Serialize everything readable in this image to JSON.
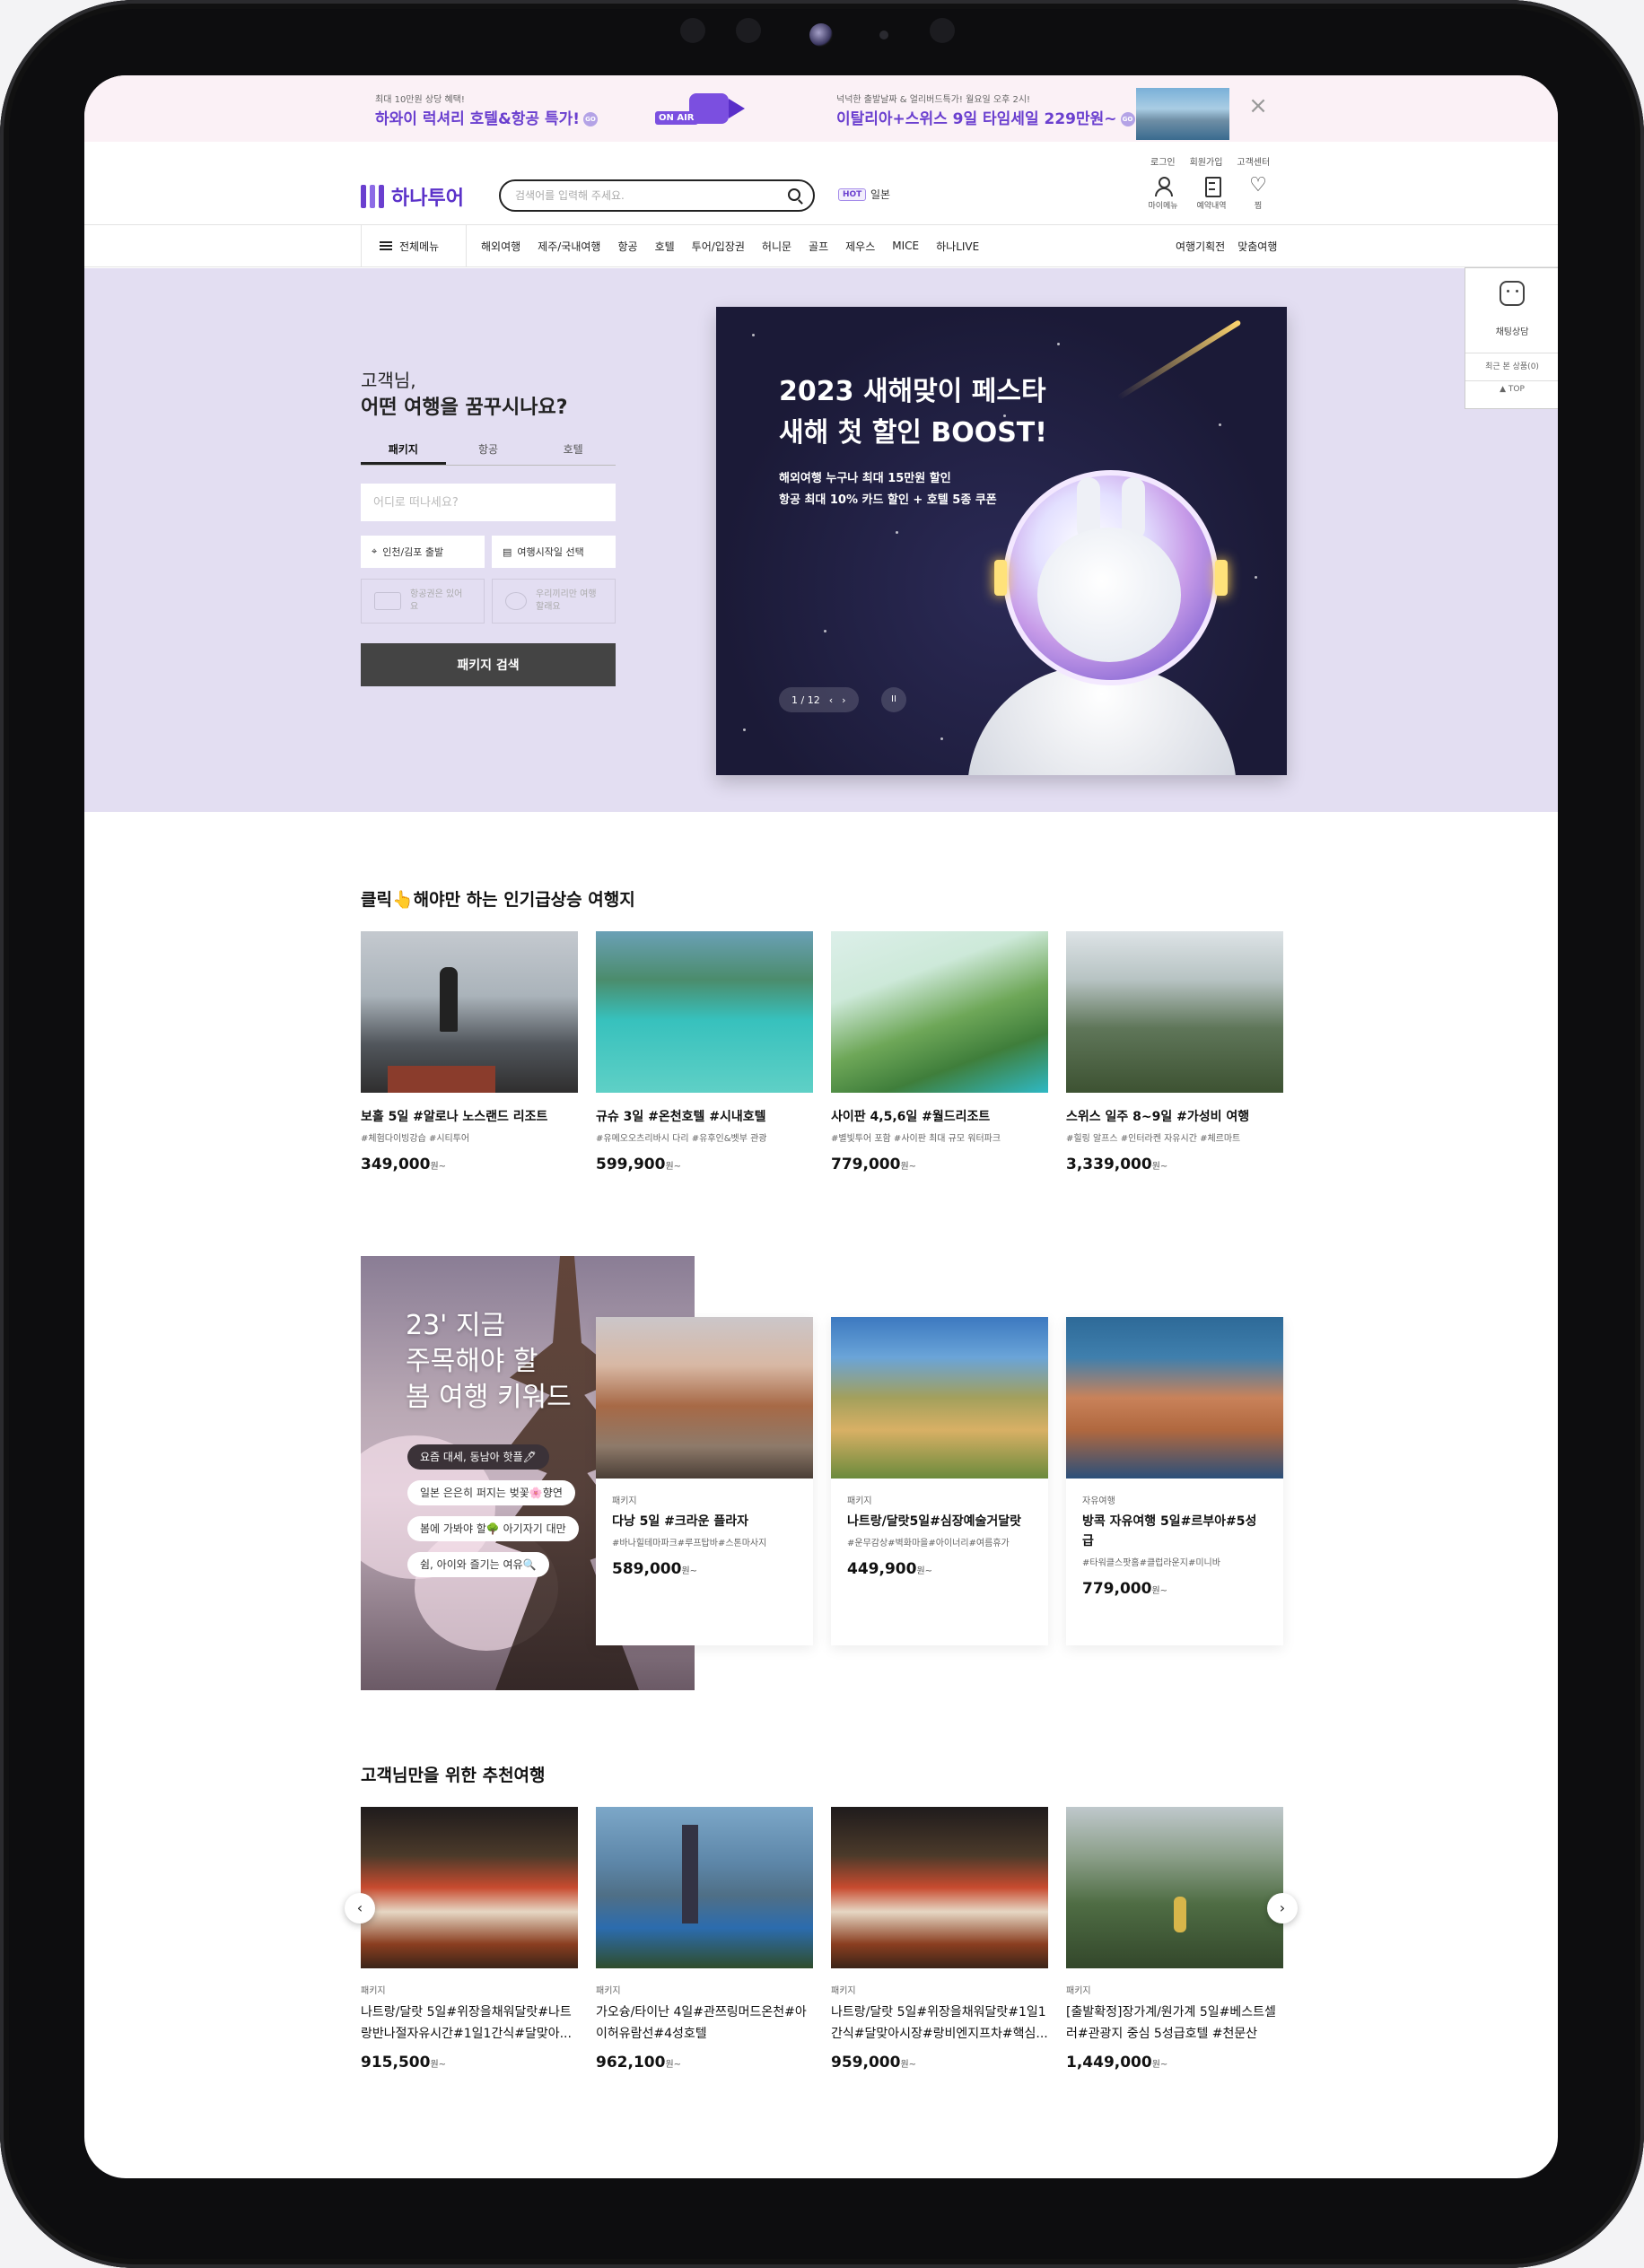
{
  "promo": {
    "left_small": "최대 10만원 상당 혜택!",
    "left_big": "하와이 럭셔리 호텔&항공 특가!",
    "go": "GO",
    "onair": "ON AIR",
    "right_small": "넉넉한 출발날짜 & 얼리버드특가! 월요일 오후 2시!",
    "right_big": "이탈리아+스위스 9일 타임세일 229만원~"
  },
  "header": {
    "logo": "하나투어",
    "search_placeholder": "검색어를 입력해 주세요.",
    "hot_badge": "HOT",
    "hot_keyword": "일본",
    "util_links": [
      "로그인",
      "회원가입",
      "고객센터"
    ],
    "util_icons": [
      {
        "label": "마이메뉴",
        "icon": "user-icon"
      },
      {
        "label": "예약내역",
        "icon": "document-icon"
      },
      {
        "label": "찜",
        "icon": "heart-icon"
      }
    ]
  },
  "nav": {
    "all_menu": "전체메뉴",
    "items": [
      "해외여행",
      "제주/국내여행",
      "항공",
      "호텔",
      "투어/입장권",
      "허니문",
      "골프",
      "제우스",
      "MICE",
      "하나LIVE"
    ],
    "right": [
      "여행기획전",
      "맞춤여행"
    ]
  },
  "hero": {
    "greeting_line1": "고객님,",
    "greeting_line2": "어떤 여행을 꿈꾸시나요?",
    "tabs": [
      "패키지",
      "항공",
      "호텔"
    ],
    "dest_placeholder": "어디로 떠나세요?",
    "departure": "인천/김포 출발",
    "date": "여행시작일 선택",
    "option1": "항공권은 있어요",
    "option2": "우리끼리만 여행할래요",
    "search_button": "패키지 검색",
    "banner": {
      "title1": "2023 새해맞이 페스타",
      "title2": "새해 첫 할인 BOOST!",
      "sub1": "해외여행 누구나 최대 15만원 할인",
      "sub2": "항공 최대 10% 카드 할인 + 호텔 5종 쿠폰",
      "pager": "1 / 12",
      "prev": "‹",
      "next": "›",
      "pause": "II"
    }
  },
  "side_widget": {
    "chat": "채팅상담",
    "recent": "최근 본 상품(0)",
    "top": "TOP"
  },
  "trending": {
    "title": "클릭👆해야만 하는 인기급상승 여행지",
    "cards": [
      {
        "name": "보홀 5일 #알로나 노스랜드 리조트",
        "tags": "#체험다이빙강습 #시티투어",
        "price": "349,000",
        "unit": "원~"
      },
      {
        "name": "규슈 3일 #온천호텔 #시내호텔",
        "tags": "#유메오오츠리바시 다리 #유후인&벳부 관광",
        "price": "599,900",
        "unit": "원~"
      },
      {
        "name": "사이판 4,5,6일 #월드리조트",
        "tags": "#별빛투어 포함 #사이판 최대 규모 워터파크",
        "price": "779,000",
        "unit": "원~"
      },
      {
        "name": "스위스 일주 8~9일 #가성비 여행",
        "tags": "#힐링 알프스 #인터라켄 자유시간 #체르마트",
        "price": "3,339,000",
        "unit": "원~"
      }
    ]
  },
  "keywords": {
    "title1": "23' 지금",
    "title2": "주목해야 할",
    "title3": "봄 여행 키워드",
    "pills": [
      "요즘 대세, 동남아 핫플🖊",
      "일본 은은히 퍼지는 벚꽃🌸향연",
      "봄에 가봐야 할🌳 아기자기 대만",
      "쉼, 아이와 즐기는 여유🔍"
    ],
    "cards": [
      {
        "cat": "패키지",
        "name": "다낭 5일 #크라운 플라자",
        "tags": "#바나힐테마파크#루프탑바#스톤마사지",
        "price": "589,000",
        "unit": "원~"
      },
      {
        "cat": "패키지",
        "name": "나트랑/달랏5일#심장예술거달랏",
        "tags": "#운무감상#벽화마을#아이너리#여름휴가",
        "price": "449,900",
        "unit": "원~"
      },
      {
        "cat": "자유여행",
        "name": "방콕 자유여행 5일#르부아#5성급",
        "tags": "#타워클스팟홈#클럽라운지#미니바",
        "price": "779,000",
        "unit": "원~"
      }
    ]
  },
  "recommend": {
    "title": "고객님만을 위한 추천여행",
    "prev": "‹",
    "next": "›",
    "cards": [
      {
        "cat": "패키지",
        "name": "나트랑/달랏 5일#위장을채워달랏#나트랑반나절자유시간#1일1간식#달맞아...",
        "price": "915,500",
        "unit": "원~"
      },
      {
        "cat": "패키지",
        "name": "가오슝/타이난 4일#관쯔링머드온천#아이허유람선#4성호텔",
        "price": "962,100",
        "unit": "원~"
      },
      {
        "cat": "패키지",
        "name": "나트랑/달랏 5일#위장을채워달랏#1일1간식#달맞아시장#랑비엔지프차#핵심...",
        "price": "959,000",
        "unit": "원~"
      },
      {
        "cat": "패키지",
        "name": "[출발확정]장가계/원가계 5일#베스트셀러#관광지 중심 5성급호텔 #천문산+천...",
        "price": "1,449,000",
        "unit": "원~"
      }
    ]
  }
}
